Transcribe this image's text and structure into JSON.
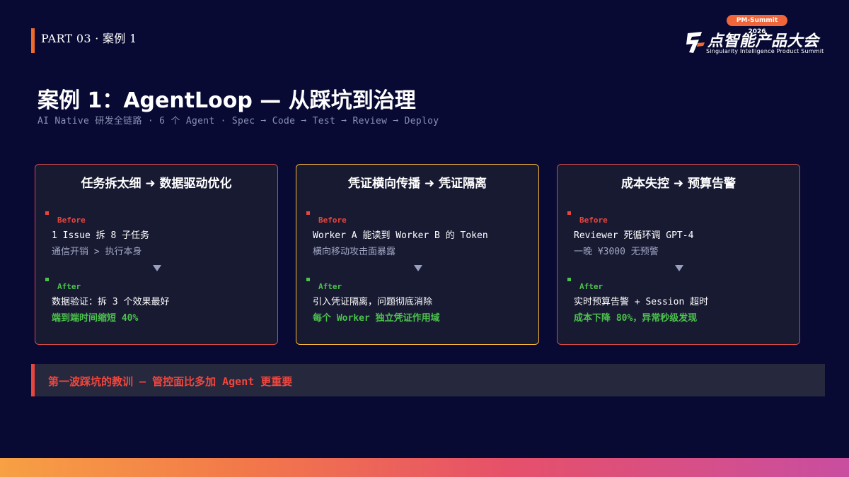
{
  "header": {
    "part_label": "PART 03 · 案例 1"
  },
  "logo": {
    "badge": "PM-Summit 2026",
    "title": "点智能产品大会",
    "subtitle": "Singularity Intelligence Product Summit",
    "icon": "summit-logo-icon"
  },
  "title": "案例 1：AgentLoop — 从踩坑到治理",
  "subtitle": "AI Native 研发全链路 · 6 个 Agent · Spec ➞ Code ➞ Test ➞ Review ➞ Deploy",
  "cards": [
    {
      "title": "任务拆太细 ➜ 数据驱动优化",
      "before_label": "Before",
      "before_line1": "1 Issue 拆 8 子任务",
      "before_line2": "通信开销 > 执行本身",
      "after_label": "After",
      "after_line1": "数据验证：拆 3 个效果最好",
      "after_line2": "端到端时间缩短 40%"
    },
    {
      "title": "凭证横向传播 ➜ 凭证隔离",
      "before_label": "Before",
      "before_line1": "Worker A 能读到 Worker B 的 Token",
      "before_line2": "横向移动攻击面暴露",
      "after_label": "After",
      "after_line1": "引入凭证隔离，问题彻底消除",
      "after_line2": "每个 Worker 独立凭证作用域"
    },
    {
      "title": "成本失控 ➜ 预算告警",
      "before_label": "Before",
      "before_line1": "Reviewer 死循环调 GPT-4",
      "before_line2": "一晚 ¥3000 无预警",
      "after_label": "After",
      "after_line1": "实时预算告警 + Session 超时",
      "after_line2": "成本下降 80%，异常秒级发现"
    }
  ],
  "lesson": "第一波踩坑的教训 — 管控面比多加 Agent 更重要",
  "colors": {
    "background": "#080a33",
    "accent_red": "#e8453c",
    "accent_green": "#4cc24c",
    "accent_gold": "#f4b43a",
    "accent_orange": "#f26a2a"
  }
}
